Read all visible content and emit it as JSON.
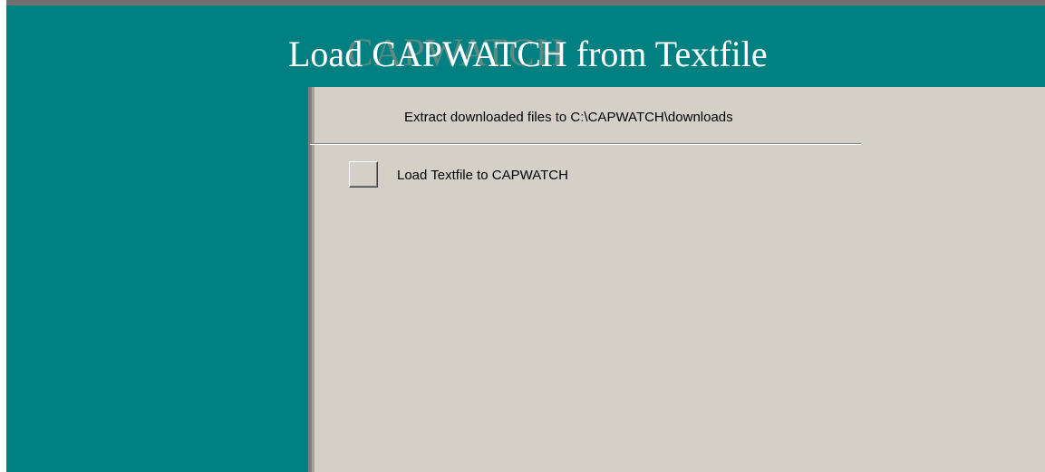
{
  "form": {
    "title": "Load CAPWATCH from Textfile",
    "title_shadow": "CAPWATCH"
  },
  "panel": {
    "extract_label": "Extract downloaded files to C:\\CAPWATCH\\downloads",
    "load_button_label": "Load Textfile to CAPWATCH"
  },
  "colors": {
    "background": "#008080",
    "panel": "#d4d0c8",
    "title": "#ffffff"
  }
}
